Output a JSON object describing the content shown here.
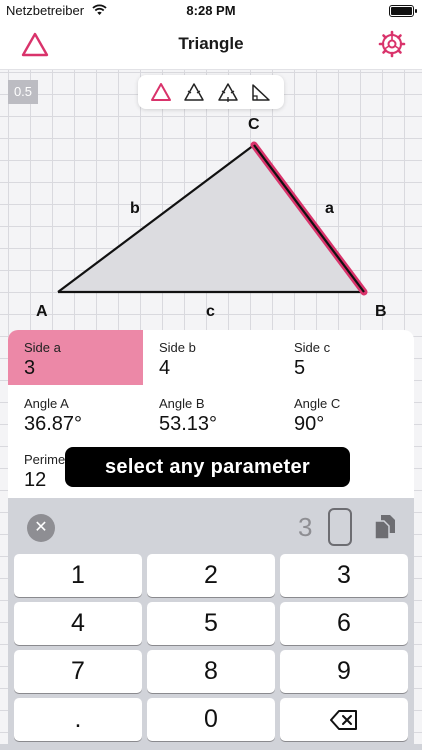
{
  "status_bar": {
    "carrier": "Netzbetreiber",
    "time": "8:28 PM"
  },
  "nav": {
    "title": "Triangle",
    "left_icon": "triangle-outline-icon",
    "right_icon": "gear-icon"
  },
  "accent_color": "#d9336b",
  "scale_badge": "0.5",
  "type_switcher": [
    "triangle-general-icon",
    "triangle-isosceles-icon",
    "triangle-equilateral-icon",
    "triangle-right-icon"
  ],
  "vertices": {
    "A": "A",
    "B": "B",
    "C": "C"
  },
  "sides": {
    "a": "a",
    "b": "b",
    "c": "c"
  },
  "parameters": {
    "side_a": {
      "name": "Side a",
      "value": "3"
    },
    "side_b": {
      "name": "Side b",
      "value": "4"
    },
    "side_c": {
      "name": "Side c",
      "value": "5"
    },
    "angle_a": {
      "name": "Angle A",
      "value": "36.87°"
    },
    "angle_b": {
      "name": "Angle B",
      "value": "53.13°"
    },
    "angle_c": {
      "name": "Angle C",
      "value": "90°"
    },
    "perimeter": {
      "name": "Perimet",
      "value": "12"
    }
  },
  "tooltip": "select any parameter",
  "input": {
    "value": "3"
  },
  "keys": [
    "1",
    "2",
    "3",
    "4",
    "5",
    "6",
    "7",
    "8",
    "9",
    ".",
    "0"
  ]
}
